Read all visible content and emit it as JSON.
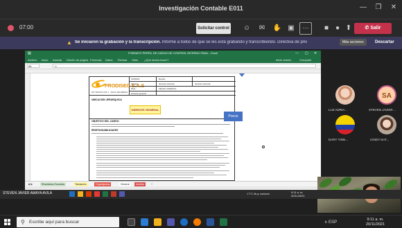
{
  "window": {
    "title": "Investigación Contable E011"
  },
  "meeting": {
    "timer": "07:00",
    "request_control_label": "Solicitar control",
    "more_label": "···",
    "leave_label": "Salir",
    "leave_chevron": "v"
  },
  "banner": {
    "bold_text": "Se iniciaron la grabación y la transcripción.",
    "rest_text": "Informe a todos de que se les está grabando y transcribiendo. Directiva de priv",
    "more_actions": "Más acciones",
    "dismiss": "Descartar"
  },
  "excel": {
    "title": "FORMATO PERFIL DE CARGO DE CONTROL INTERNO FINAL - Excel",
    "menu": [
      "Archivo",
      "Inicio",
      "Insertar",
      "Diseño de página",
      "Fórmulas",
      "Datos",
      "Revisar",
      "Vista",
      "¿Qué desea hacer?"
    ],
    "share_label": "Compartir",
    "user_label": "Inicie sesión",
    "name_box": "A1",
    "formula_placeholder": "fx",
    "document": {
      "company": "PRODISEG S.A.S",
      "company_sub": "NIT 900.527.076-1 · SOLO SE DIBUJA",
      "header_cells": [
        "CODIGO:",
        "Versión:",
        "Revisó:",
        "Gerente General",
        "Gerente General",
        "PAG.:",
        "FECHA VIGENCIA:",
        "Gerente general"
      ],
      "section_ubicacion": "UBICACIÓN JERARQUICA",
      "role_box": "GERENTE GENERAL",
      "section_objetivo": "OBJETIVO DEL CARGO",
      "section_responsabilidades": "RESPONSABILIDADES"
    },
    "shape_label": "Precio",
    "sheet_nav": "◀ ▶",
    "sheet_tabs": [
      "Resultados Encuesta",
      "Tabulación",
      "Organigrama",
      "General",
      "Análisis",
      "+"
    ]
  },
  "participants": [
    {
      "name": "LUZ ADRIA...",
      "avatar": "photo"
    },
    {
      "name": "STEVEN JAVIER ...",
      "avatar": "initials",
      "initials": "SA"
    },
    {
      "name": "DARY YINN...",
      "avatar": "flag"
    },
    {
      "name": "CINDY NAT...",
      "avatar": "photo"
    }
  ],
  "shared_taskbar": {
    "presenter": "STEVEN JAVIER AMAYA AVILA",
    "weather": "17°C  Muy nublado",
    "clock_time": "9:11 a. m.",
    "clock_date": "20/11/2021"
  },
  "taskbar": {
    "search_placeholder": "Escribe aquí para buscar",
    "tray": "∧ ESP",
    "clock_time": "9:11 a. m.",
    "clock_date": "20/11/2021"
  }
}
